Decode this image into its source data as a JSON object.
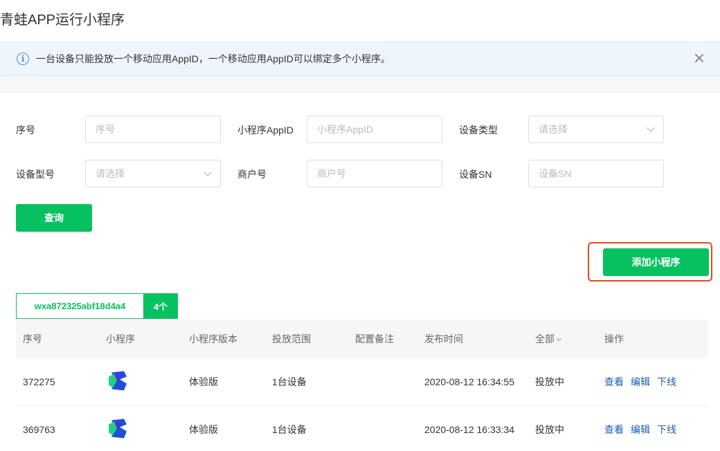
{
  "header": {
    "title": "青蛙APP运行小程序"
  },
  "alert": {
    "text": "一台设备只能投放一个移动应用AppID，一个移动应用AppID可以绑定多个小程序。"
  },
  "filters": {
    "seq_label": "序号",
    "seq_placeholder": "序号",
    "appid_label": "小程序AppID",
    "appid_placeholder": "小程序AppID",
    "device_type_label": "设备类型",
    "device_type_value": "请选择",
    "device_model_label": "设备型号",
    "device_model_value": "请选择",
    "merchant_label": "商户号",
    "merchant_placeholder": "商户号",
    "sn_label": "设备SN",
    "sn_placeholder": "设备SN",
    "query_button": "查询"
  },
  "add_button": "添加小程序",
  "app_tab": {
    "appid": "wxa872325abf18d4a4",
    "count": "4个"
  },
  "table": {
    "headers": {
      "seq": "序号",
      "app": "小程序",
      "version": "小程序版本",
      "scope": "投放范围",
      "note": "配置备注",
      "time": "发布时间",
      "status": "全部",
      "ops": "操作"
    },
    "rows": [
      {
        "seq": "372275",
        "version": "体验版",
        "scope": "1台设备",
        "note": "",
        "time": "2020-08-12 16:34:55",
        "status": "投放中",
        "ops": [
          "查看",
          "编辑",
          "下线"
        ]
      },
      {
        "seq": "369763",
        "version": "体验版",
        "scope": "1台设备",
        "note": "",
        "time": "2020-08-12 16:33:34",
        "status": "投放中",
        "ops": [
          "查看",
          "编辑",
          "下线"
        ]
      }
    ]
  },
  "colors": {
    "accent": "#07c160",
    "link": "#1f5bb5",
    "highlight": "#e8461b"
  }
}
